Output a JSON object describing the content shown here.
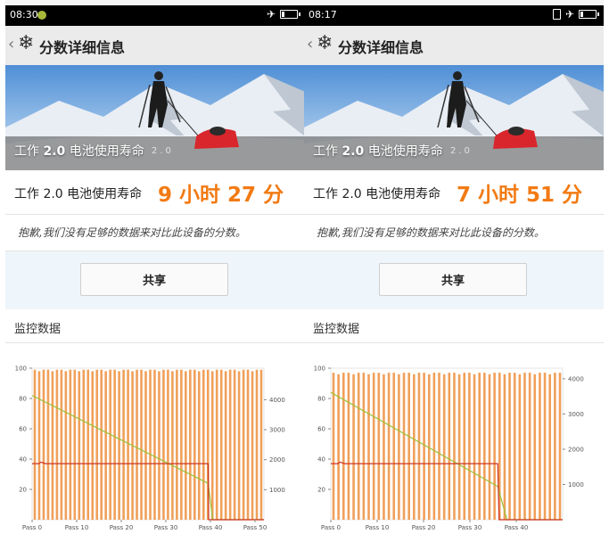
{
  "panels": [
    {
      "status_time": "08:30",
      "header_title": "分数详细信息",
      "hero_label_prefix": "工作",
      "hero_label_version": "2.0",
      "hero_label_suffix": "电池使用寿命",
      "hero_ghost": "2.0",
      "result_label": "工作 2.0 电池使用寿命",
      "result_value": "9 小时 27 分",
      "sorry_text": "抱歉,我们没有足够的数据来对比此设备的分数。",
      "share_label": "共享",
      "monitor_title": "监控数据",
      "chart_data": {
        "type": "bar",
        "series": [
          {
            "values_note": "temperature",
            "level_left": 37,
            "flat_until_pass": 39.5
          },
          {
            "values_note": "battery",
            "start": 82,
            "end_pass": 40.5
          }
        ],
        "bars": {
          "count": 52,
          "top_left_axis": 99
        },
        "battery_line": [
          [
            0,
            82
          ],
          [
            39.5,
            24
          ],
          [
            40.5,
            0
          ],
          [
            52,
            0
          ]
        ],
        "temp_line": [
          [
            0,
            37
          ],
          [
            1.5,
            37
          ],
          [
            2,
            38
          ],
          [
            3,
            37
          ],
          [
            39,
            37
          ],
          [
            39.5,
            37
          ],
          [
            39.6,
            0
          ],
          [
            52,
            0
          ]
        ],
        "x_max": 52,
        "left_ticks": [
          "100",
          "80",
          "60",
          "40",
          "20"
        ],
        "right_ticks": [
          "4000",
          "3000",
          "2000",
          "1000"
        ],
        "right_max": 5050,
        "x_ticks": [
          {
            "value": 0,
            "label": "Pass 0"
          },
          {
            "value": 10,
            "label": "Pass 10"
          },
          {
            "value": 20,
            "label": "Pass 20"
          },
          {
            "value": 30,
            "label": "Pass 30"
          },
          {
            "value": 40,
            "label": "Pass 40"
          },
          {
            "value": 50,
            "label": "Pass 50"
          }
        ]
      }
    },
    {
      "status_time": "08:17",
      "header_title": "分数详细信息",
      "hero_label_prefix": "工作",
      "hero_label_version": "2.0",
      "hero_label_suffix": "电池使用寿命",
      "hero_ghost": "2.0",
      "result_label": "工作 2.0 电池使用寿命",
      "result_value": "7 小时 51 分",
      "sorry_text": "抱歉,我们没有足够的数据来对比此设备的分数。",
      "share_label": "共享",
      "monitor_title": "监控数据",
      "chart_data": {
        "type": "bar",
        "bars": {
          "count": 46,
          "top_left_axis": 97
        },
        "battery_line": [
          [
            0,
            84
          ],
          [
            36,
            22
          ],
          [
            38,
            0
          ],
          [
            50,
            0
          ]
        ],
        "temp_line": [
          [
            0,
            37
          ],
          [
            1.5,
            37
          ],
          [
            2,
            38
          ],
          [
            3,
            37
          ],
          [
            36,
            37
          ],
          [
            36.3,
            0
          ],
          [
            50,
            0
          ]
        ],
        "x_max": 50,
        "left_ticks": [
          "100",
          "80",
          "60",
          "40",
          "20"
        ],
        "right_ticks": [
          "4000",
          "3000",
          "2000",
          "1000"
        ],
        "right_max": 4300,
        "x_ticks": [
          {
            "value": 0,
            "label": "Pass 0"
          },
          {
            "value": 10,
            "label": "Pass 10"
          },
          {
            "value": 20,
            "label": "Pass 20"
          },
          {
            "value": 30,
            "label": "Pass 30"
          },
          {
            "value": 40,
            "label": "Pass 40"
          }
        ]
      }
    }
  ],
  "colors": {
    "accent": "#f27a13",
    "bar": "#f0a05a",
    "battery_line": "#9bc23a",
    "temp_line": "#cc3322"
  },
  "icons": [
    "back-chevron-icon",
    "snowflake-icon",
    "airplane-mode-icon",
    "battery-icon",
    "vibrate-icon",
    "status-app-icon"
  ]
}
